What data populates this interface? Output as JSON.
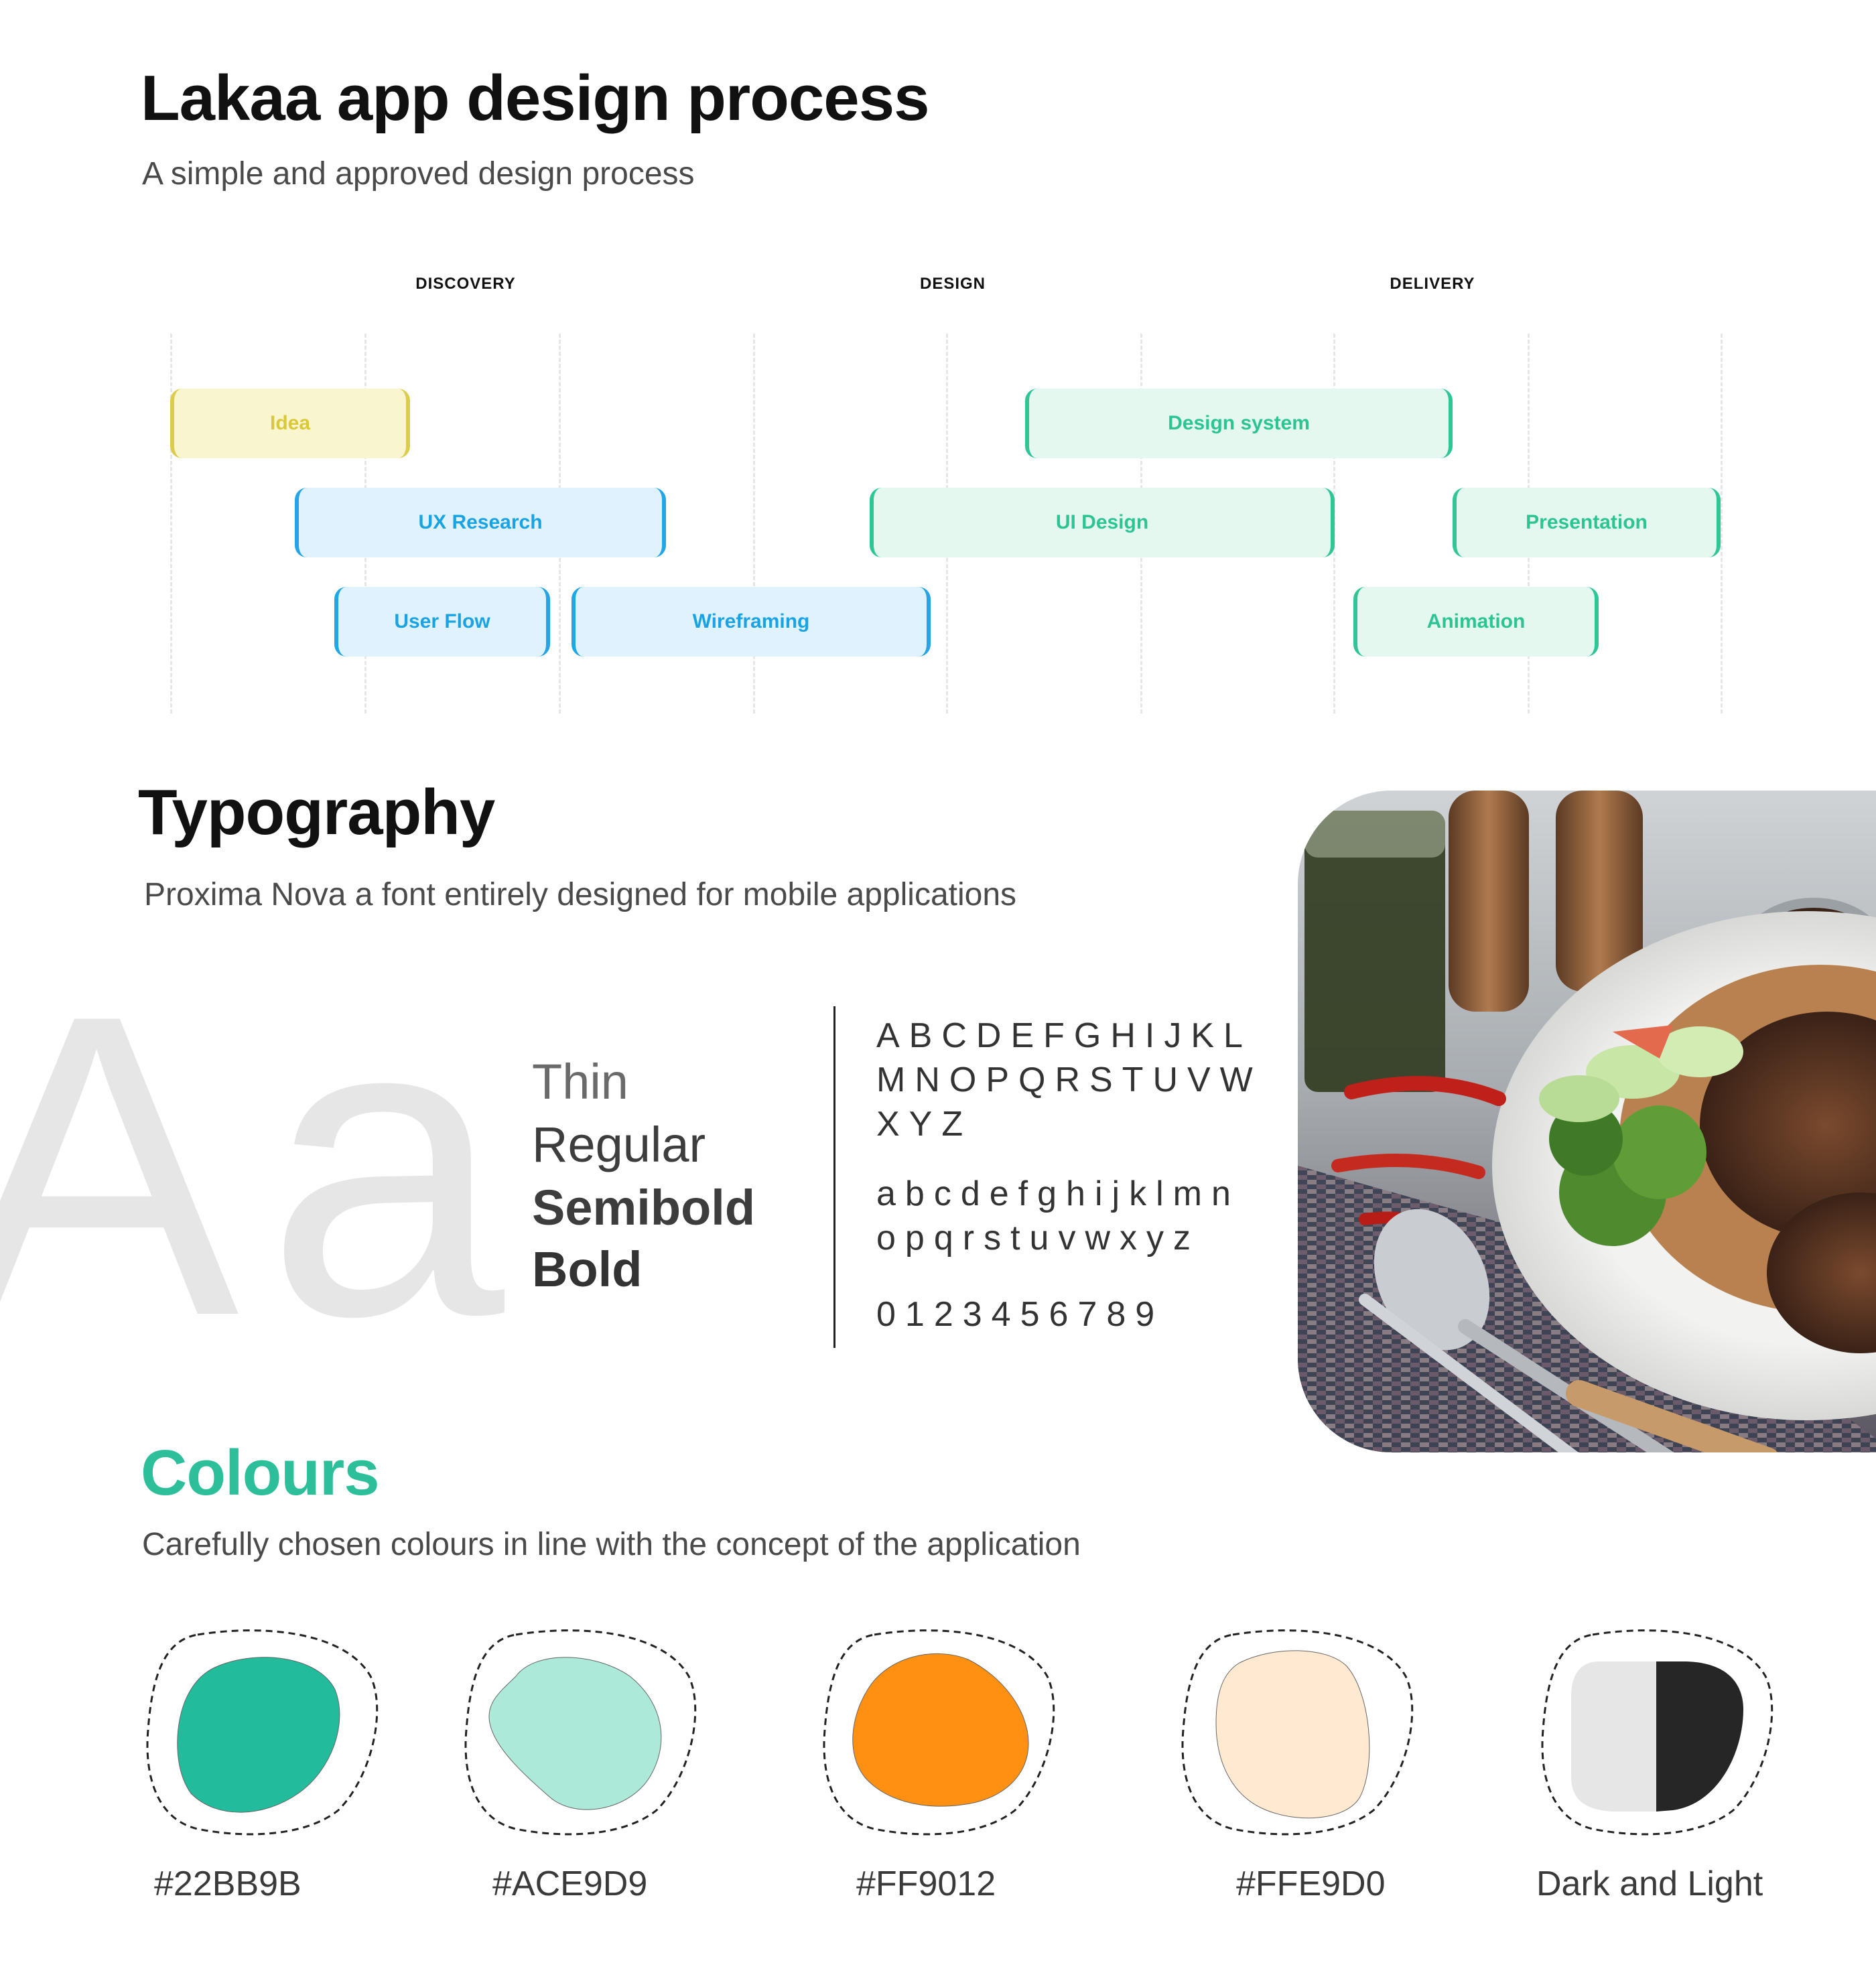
{
  "process": {
    "title": "Lakaa app design process",
    "subtitle": "A simple and approved design process",
    "phases": [
      "DISCOVERY",
      "DESIGN",
      "DELIVERY"
    ],
    "tasks": {
      "idea": "Idea",
      "ux_research": "UX Research",
      "user_flow": "User Flow",
      "wireframing": "Wireframing",
      "design_system": "Design system",
      "ui_design": "UI Design",
      "presentation": "Presentation",
      "animation": "Animation"
    }
  },
  "typography": {
    "title": "Typography",
    "subtitle": "Proxima Nova a font entirely designed for mobile applications",
    "sample": "Aa",
    "weights": [
      "Thin",
      "Regular",
      "Semibold",
      "Bold"
    ],
    "uppercase": [
      "ABCDEFGHIJKL",
      "MNOPQRSTUVW",
      "XYZ"
    ],
    "lowercase": [
      "abcdefghijklmn",
      "opqrstuvwxyz"
    ],
    "digits": "0123456789"
  },
  "colours": {
    "title": "Colours",
    "subtitle": "Carefully chosen colours in line with the concept of the application",
    "palette": [
      {
        "label": "#22BB9B",
        "color": "#22BB9B"
      },
      {
        "label": "#ACE9D9",
        "color": "#ACE9D9"
      },
      {
        "label": "#FF9012",
        "color": "#FF9012"
      },
      {
        "label": "#FFE9D0",
        "color": "#FFE9D0"
      },
      {
        "label": "Dark and Light",
        "dark": "#262626",
        "light": "#E6E6E6"
      }
    ]
  }
}
